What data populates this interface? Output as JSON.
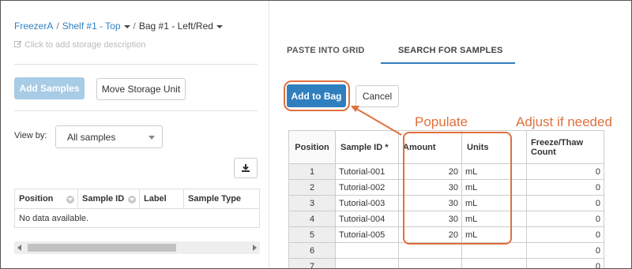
{
  "breadcrumb": {
    "freezer": "FreezerA",
    "sep1": "/",
    "shelf": "Shelf #1 - Top",
    "sep2": "/",
    "bag": "Bag #1 - Left/Red"
  },
  "description_placeholder": "Click to add storage description",
  "left_buttons": {
    "add_samples": "Add Samples",
    "move_storage": "Move Storage Unit"
  },
  "view_by": {
    "label": "View by:",
    "selected": "All samples"
  },
  "left_table": {
    "columns": [
      "Position",
      "Sample ID",
      "Label",
      "Sample Type"
    ],
    "empty_text": "No data available."
  },
  "tabs": {
    "paste": "PASTE INTO GRID",
    "search": "SEARCH FOR SAMPLES"
  },
  "grid_buttons": {
    "add_to_bag": "Add to Bag",
    "cancel": "Cancel"
  },
  "grid": {
    "headers": {
      "position": "Position",
      "sample_id": "Sample ID *",
      "amount": "Amount",
      "units": "Units",
      "freeze_thaw": "Freeze/Thaw Count"
    },
    "rows": [
      {
        "pos": "1",
        "sample_id": "Tutorial-001",
        "amount": "20",
        "units": "mL",
        "ft": "0"
      },
      {
        "pos": "2",
        "sample_id": "Tutorial-002",
        "amount": "30",
        "units": "mL",
        "ft": "0"
      },
      {
        "pos": "3",
        "sample_id": "Tutorial-003",
        "amount": "30",
        "units": "mL",
        "ft": "0"
      },
      {
        "pos": "4",
        "sample_id": "Tutorial-004",
        "amount": "30",
        "units": "mL",
        "ft": "0"
      },
      {
        "pos": "5",
        "sample_id": "Tutorial-005",
        "amount": "20",
        "units": "mL",
        "ft": "0"
      },
      {
        "pos": "6",
        "sample_id": "",
        "amount": "",
        "units": "",
        "ft": "0"
      },
      {
        "pos": "7",
        "sample_id": "",
        "amount": "",
        "units": "",
        "ft": "0"
      }
    ]
  },
  "annotations": {
    "populate": "Populate",
    "adjust": "Adjust if needed"
  },
  "colors": {
    "accent": "#2f7fbf",
    "annotation": "#e0703d"
  }
}
